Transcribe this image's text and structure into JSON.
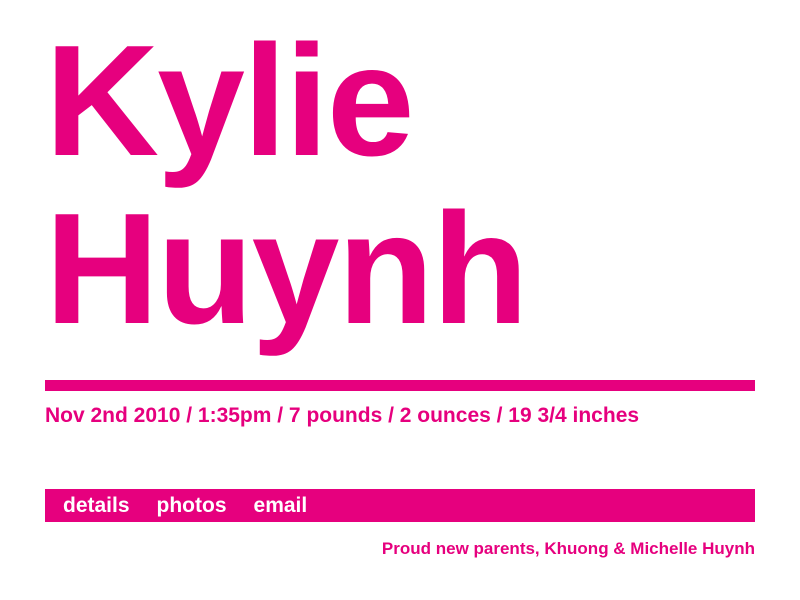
{
  "theme": {
    "accent_color": "#e6007e",
    "background_color": "#ffffff",
    "nav_text_color": "#ffffff"
  },
  "header": {
    "first_name": "Kylie",
    "last_name": "Huynh"
  },
  "birth": {
    "details_text": "Nov 2nd 2010 / 1:35pm / 7 pounds / 2 ounces / 19 3/4 inches"
  },
  "nav": {
    "items": [
      {
        "label": "details"
      },
      {
        "label": "photos"
      },
      {
        "label": "email"
      }
    ]
  },
  "footer": {
    "parents_text": "Proud new parents, Khuong & Michelle Huynh"
  }
}
